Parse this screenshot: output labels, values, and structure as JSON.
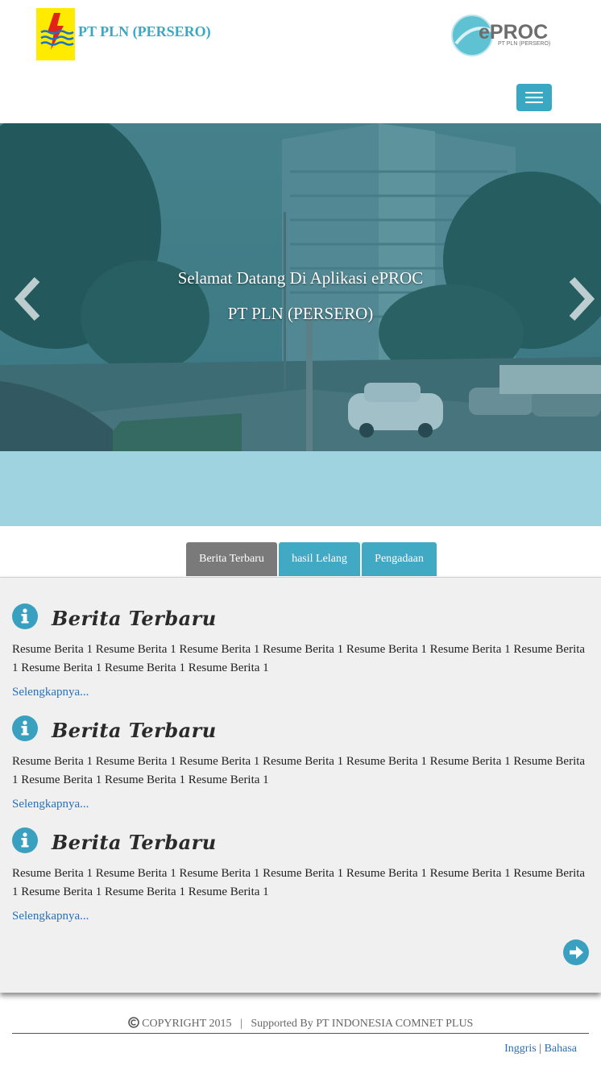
{
  "header": {
    "company_name": "PT PLN (PERSERO)",
    "eproc_logo_main": "ePROC",
    "eproc_logo_sub": "PT PLN (PERSERO)",
    "accent_color": "#3aa8c3"
  },
  "hero": {
    "caption_line1": "Selamat Datang Di Aplikasi ePROC",
    "caption_line2": "PT PLN (PERSERO)"
  },
  "tabs": [
    {
      "label": "Berita Terbaru",
      "active": true
    },
    {
      "label": "hasil Lelang",
      "active": false
    },
    {
      "label": "Pengadaan",
      "active": false
    }
  ],
  "news": [
    {
      "title": "Berita Terbaru",
      "body": "Resume Berita 1 Resume Berita 1 Resume Berita 1 Resume Berita 1 Resume Berita 1 Resume Berita 1 Resume Berita 1 Resume Berita 1 Resume Berita 1 Resume Berita 1",
      "more": "Selengkapnya..."
    },
    {
      "title": "Berita Terbaru",
      "body": "Resume Berita 1 Resume Berita 1 Resume Berita 1 Resume Berita 1 Resume Berita 1 Resume Berita 1 Resume Berita 1 Resume Berita 1 Resume Berita 1 Resume Berita 1",
      "more": "Selengkapnya..."
    },
    {
      "title": "Berita Terbaru",
      "body": "Resume Berita 1 Resume Berita 1 Resume Berita 1 Resume Berita 1 Resume Berita 1 Resume Berita 1 Resume Berita 1 Resume Berita 1 Resume Berita 1 Resume Berita 1",
      "more": "Selengkapnya..."
    }
  ],
  "footer": {
    "copyright": "COPYRIGHT 2015",
    "separator": "|",
    "supported_by": "Supported By PT INDONESIA COMNET PLUS",
    "lang_english": "Inggris",
    "lang_sep": "|",
    "lang_bahasa": "Bahasa"
  }
}
